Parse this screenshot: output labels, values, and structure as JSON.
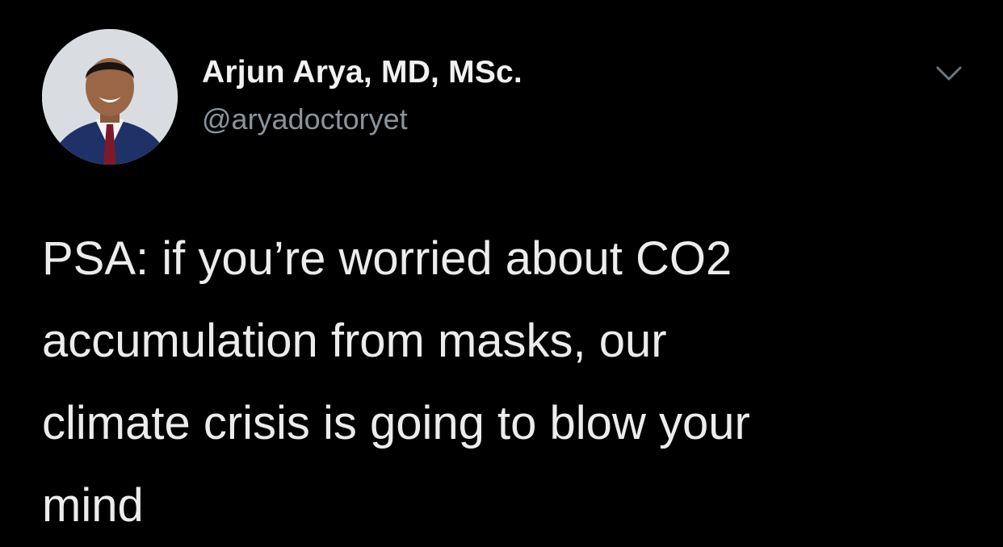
{
  "tweet": {
    "author": {
      "display_name": "Arjun Arya, MD, MSc.",
      "handle": "@aryadoctoryet",
      "avatar_icon": "profile-photo"
    },
    "menu_icon": "chevron-down-icon",
    "text": "PSA: if you’re worried about CO2\naccumulation from masks, our\nclimate crisis is going to blow your\nmind"
  },
  "colors": {
    "background": "#000000",
    "name": "#f1f1f1",
    "handle": "#8b949c",
    "text": "#ececec"
  }
}
